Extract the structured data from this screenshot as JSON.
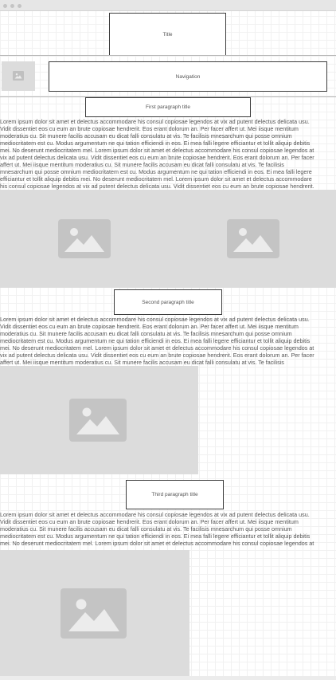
{
  "header": {
    "title": "Title",
    "navigation": "Navigation"
  },
  "sections": [
    {
      "title": "First paragraph title",
      "lines": [
        "Lorem ipsum dolor sit amet et delectus accommodare his consul copiosae legendos at vix ad putent delectus delicata usu.",
        "Vidit dissentiet eos cu eum an brute copiosae hendrerit. Eos erant dolorum an. Per facer affert ut. Mei iisque mentitum",
        "moderatius cu. Sit munere facilis accusam eu dicat falli consulatu at vis. Te facilisis mnesarchum qui posse omnium",
        "mediocritatem est cu. Modus argumentum ne qui tation efficiendi in eos. Ei mea falli legere efficiantur et tollit aliquip debitis",
        "mei. No deserunt mediocritatem mel. Lorem ipsum dolor sit amet et delectus accommodare his consul copiosae legendos at",
        "vix ad putent delectus delicata usu. Vidit dissentiet eos cu eum an brute copiosae hendrerit. Eos erant dolorum an. Per facer",
        "affert ut. Mei iisque mentitum moderatius cu. Sit munere facilis accusam eu dicat falli consulatu at vis. Te facilisis",
        "mnesarchum qui posse omnium mediocritatem est cu. Modus argumentum ne qui tation efficiendi in eos. Ei mea falli legere",
        "efficiantur et tollit aliquip debitis mei. No deserunt mediocritatem mel. Lorem ipsum dolor sit amet et delectus accommodare",
        "his consul copiosae legendos at vix ad putent delectus delicata usu. Vidit dissentiet eos cu eum an brute copiosae hendrerit."
      ]
    },
    {
      "title": "Second paragraph title",
      "lines": [
        "Lorem ipsum dolor sit amet et delectus accommodare his consul copiosae legendos at vix ad putent delectus delicata usu.",
        "Vidit dissentiet eos cu eum an brute copiosae hendrerit. Eos erant dolorum an. Per facer affert ut. Mei iisque mentitum",
        "moderatius cu. Sit munere facilis accusam eu dicat falli consulatu at vis. Te facilisis mnesarchum qui posse omnium",
        "mediocritatem est cu. Modus argumentum ne qui tation efficiendi in eos. Ei mea falli legere efficiantur et tollit aliquip debitis",
        "mei. No deserunt mediocritatem mel. Lorem ipsum dolor sit amet et delectus accommodare his consul copiosae legendos at",
        "vix ad putent delectus delicata usu. Vidit dissentiet eos cu eum an brute copiosae hendrerit. Eos erant dolorum an. Per facer",
        "affert ut. Mei iisque mentitum moderatius cu. Sit munere facilis accusam eu dicat falli consulatu at vis. Te facilisis"
      ]
    },
    {
      "title": "Third paragraph title",
      "lines": [
        "Lorem ipsum dolor sit amet et delectus accommodare his consul copiosae legendos at vix ad putent delectus delicata usu.",
        "Vidit dissentiet eos cu eum an brute copiosae hendrerit. Eos erant dolorum an. Per facer affert ut. Mei iisque mentitum",
        "moderatius cu. Sit munere facilis accusam eu dicat falli consulatu at vis. Te facilisis mnesarchum qui posse omnium",
        "mediocritatem est cu. Modus argumentum ne qui tation efficiendi in eos. Ei mea falli legere efficiantur et tollit aliquip debitis",
        "mei. No deserunt mediocritatem mel. Lorem ipsum dolor sit amet et delectus accommodare his consul copiosae legendos at"
      ]
    }
  ],
  "icons": {
    "logo": "image-placeholder-icon",
    "images": "image-placeholder-icon"
  },
  "colors": {
    "placeholder_block": "#dcdcdc",
    "placeholder_thumb": "#c4c4c4",
    "border": "#3c3c3c",
    "text": "#555555"
  }
}
